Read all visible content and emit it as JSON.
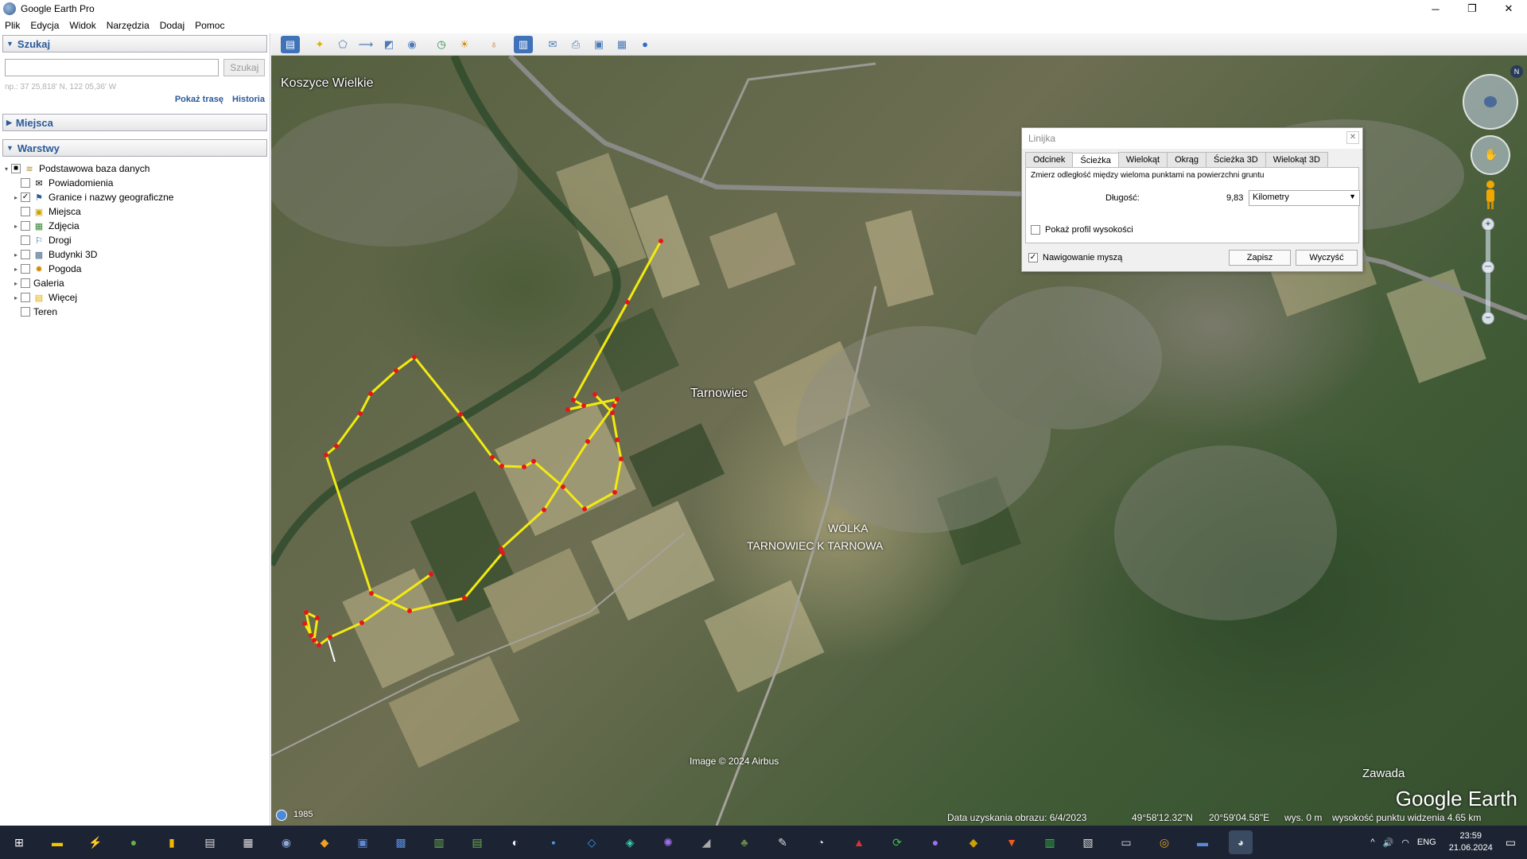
{
  "window": {
    "title": "Google Earth Pro",
    "minimize": "─",
    "maximize": "❐",
    "close": "✕"
  },
  "menu": [
    "Plik",
    "Edycja",
    "Widok",
    "Narzędzia",
    "Dodaj",
    "Pomoc"
  ],
  "search": {
    "header": "Szukaj",
    "placeholder": "",
    "button": "Szukaj",
    "hint": "np.: 37 25,818' N, 122 05,36' W",
    "link_route": "Pokaż trasę",
    "link_history": "Historia"
  },
  "places": {
    "header": "Miejsca"
  },
  "layers": {
    "header": "Warstwy",
    "items": [
      {
        "label": "Podstawowa baza danych",
        "icon": "database-icon",
        "checked": "■",
        "expander": "▾"
      },
      {
        "label": "Powiadomienia",
        "icon": "envelope-icon",
        "checked": "",
        "expander": ""
      },
      {
        "label": "Granice i nazwy geograficzne",
        "icon": "flag-icon",
        "checked": "✓",
        "expander": "▸"
      },
      {
        "label": "Miejsca",
        "icon": "square-icon",
        "checked": "",
        "expander": ""
      },
      {
        "label": "Zdjęcia",
        "icon": "photo-icon",
        "checked": "",
        "expander": "▸"
      },
      {
        "label": "Drogi",
        "icon": "road-icon",
        "checked": "",
        "expander": ""
      },
      {
        "label": "Budynki 3D",
        "icon": "building-icon",
        "checked": "",
        "expander": "▸"
      },
      {
        "label": "Pogoda",
        "icon": "weather-icon",
        "checked": "",
        "expander": "▸"
      },
      {
        "label": "Galeria",
        "icon": "",
        "checked": "",
        "expander": "▸"
      },
      {
        "label": "Więcej",
        "icon": "folder-icon",
        "checked": "",
        "expander": "▸"
      },
      {
        "label": "Teren",
        "icon": "",
        "checked": "",
        "expander": ""
      }
    ]
  },
  "map_labels": {
    "koszyce": "Koszyce Wielkie",
    "tarnowiec": "Tarnowiec",
    "wolka1": "WÓLKA",
    "wolka2": "TARNOWIEC K TARNOWA",
    "zawada": "Zawada",
    "credit": "Image © 2024 Airbus",
    "logo": "Google Earth",
    "year": "1985"
  },
  "ruler": {
    "title": "Linijka",
    "close": "✕",
    "tabs": [
      "Odcinek",
      "Ścieżka",
      "Wielokąt",
      "Okrąg",
      "Ścieżka 3D",
      "Wielokąt 3D"
    ],
    "active_tab": "Ścieżka",
    "description": "Zmierz odległość między wieloma punktami na powierzchni gruntu",
    "length_label": "Długość:",
    "length_value": "9,83",
    "unit": "Kilometry",
    "profile_label": "Pokaż profil wysokości",
    "profile_checked": "",
    "mouse_nav_label": "Nawigowanie myszą",
    "mouse_nav_checked": "✓",
    "save_button": "Zapisz",
    "clear_button": "Wyczyść"
  },
  "status": {
    "date": "Data uzyskania obrazu: 6/4/2023",
    "lat": "49°58'12.32\"N",
    "lon": "20°59'04.58\"E",
    "elev": "wys.    0 m",
    "eye": "wysokość punktu widzenia    4.65 km"
  },
  "taskbar": {
    "lang": "ENG",
    "time": "23:59",
    "date": "21.06.2024",
    "tray_arrow": "^",
    "speaker": "🔊"
  },
  "colors": {
    "path": "#f2ea10",
    "point": "#e8141c",
    "accent": "#2a5a9a"
  }
}
